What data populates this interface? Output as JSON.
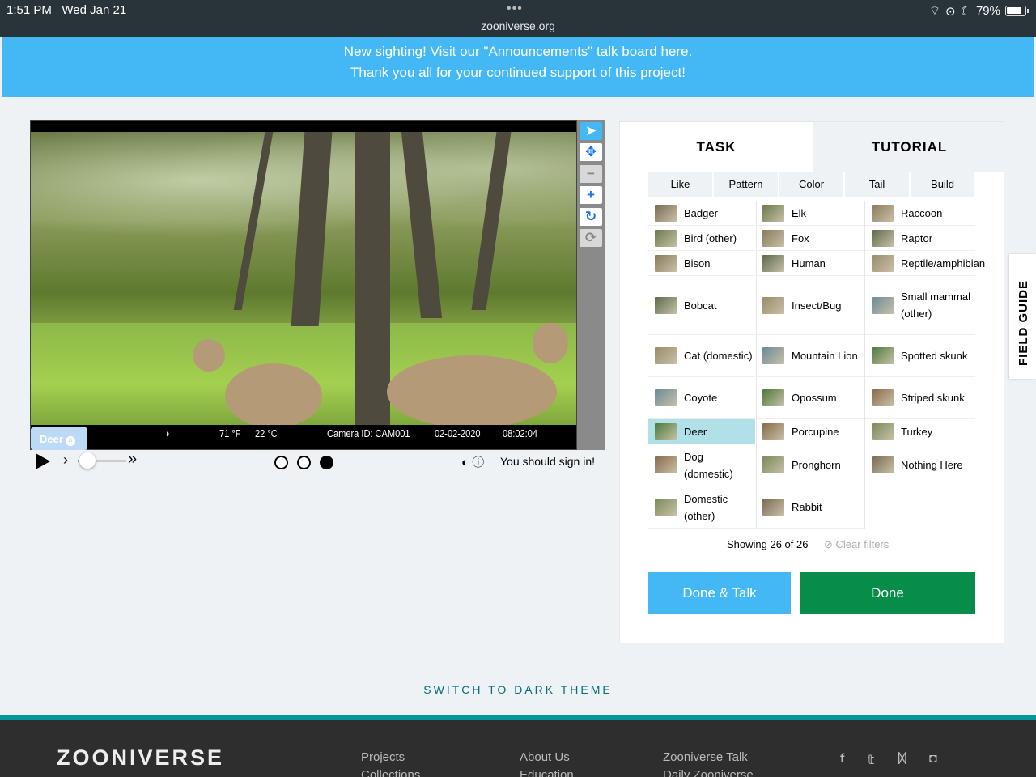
{
  "status_bar": {
    "time": "1:51 PM",
    "date": "Wed Jan 21",
    "url": "zooniverse.org",
    "battery": "79%"
  },
  "banner": {
    "line1_prefix": "New sighting! Visit our ",
    "line1_link": "\"Announcements\" talk board here",
    "line1_suffix": ".",
    "line2": "Thank you all for your continued support of this project!"
  },
  "viewer": {
    "temp_f": "71 °F",
    "temp_c": "22 °C",
    "camera_id": "Camera ID: CAM001",
    "date": "02-02-2020",
    "time": "08:02:04",
    "tag_label": "Deer",
    "signin": "You should sign in!"
  },
  "tabs": {
    "task": "TASK",
    "tutorial": "TUTORIAL"
  },
  "filters": [
    "Like",
    "Pattern",
    "Color",
    "Tail",
    "Build"
  ],
  "choices": [
    [
      "Badger",
      "Elk",
      "Raccoon"
    ],
    [
      "Bird (other)",
      "Fox",
      "Raptor"
    ],
    [
      "Bison",
      "Human",
      "Reptile/amphibian"
    ],
    [
      "Bobcat",
      "Insect/Bug",
      "Small mammal (other)"
    ],
    [
      "Cat (domestic)",
      "Mountain Lion",
      "Spotted skunk"
    ],
    [
      "Coyote",
      "Opossum",
      "Striped skunk"
    ],
    [
      "Deer",
      "Porcupine",
      "Turkey"
    ],
    [
      "Dog (domestic)",
      "Pronghorn",
      "Nothing Here"
    ],
    [
      "Domestic (other)",
      "Rabbit",
      ""
    ]
  ],
  "selected_choice": "Deer",
  "showing": "Showing 26 of 26",
  "clear_filters": "Clear filters",
  "buttons": {
    "done_talk": "Done & Talk",
    "done": "Done"
  },
  "field_guide": "FIELD GUIDE",
  "switch_theme": "SWITCH TO DARK THEME",
  "footer": {
    "logo": "ZOONIVERSE",
    "links_col1": [
      "Projects",
      "Collections"
    ],
    "links_col2": [
      "About Us",
      "Education"
    ],
    "links_col3": [
      "Zooniverse Talk",
      "Daily Zooniverse"
    ],
    "social": [
      "facebook-icon",
      "twitter-icon",
      "bluesky-icon",
      "instagram-icon"
    ]
  }
}
